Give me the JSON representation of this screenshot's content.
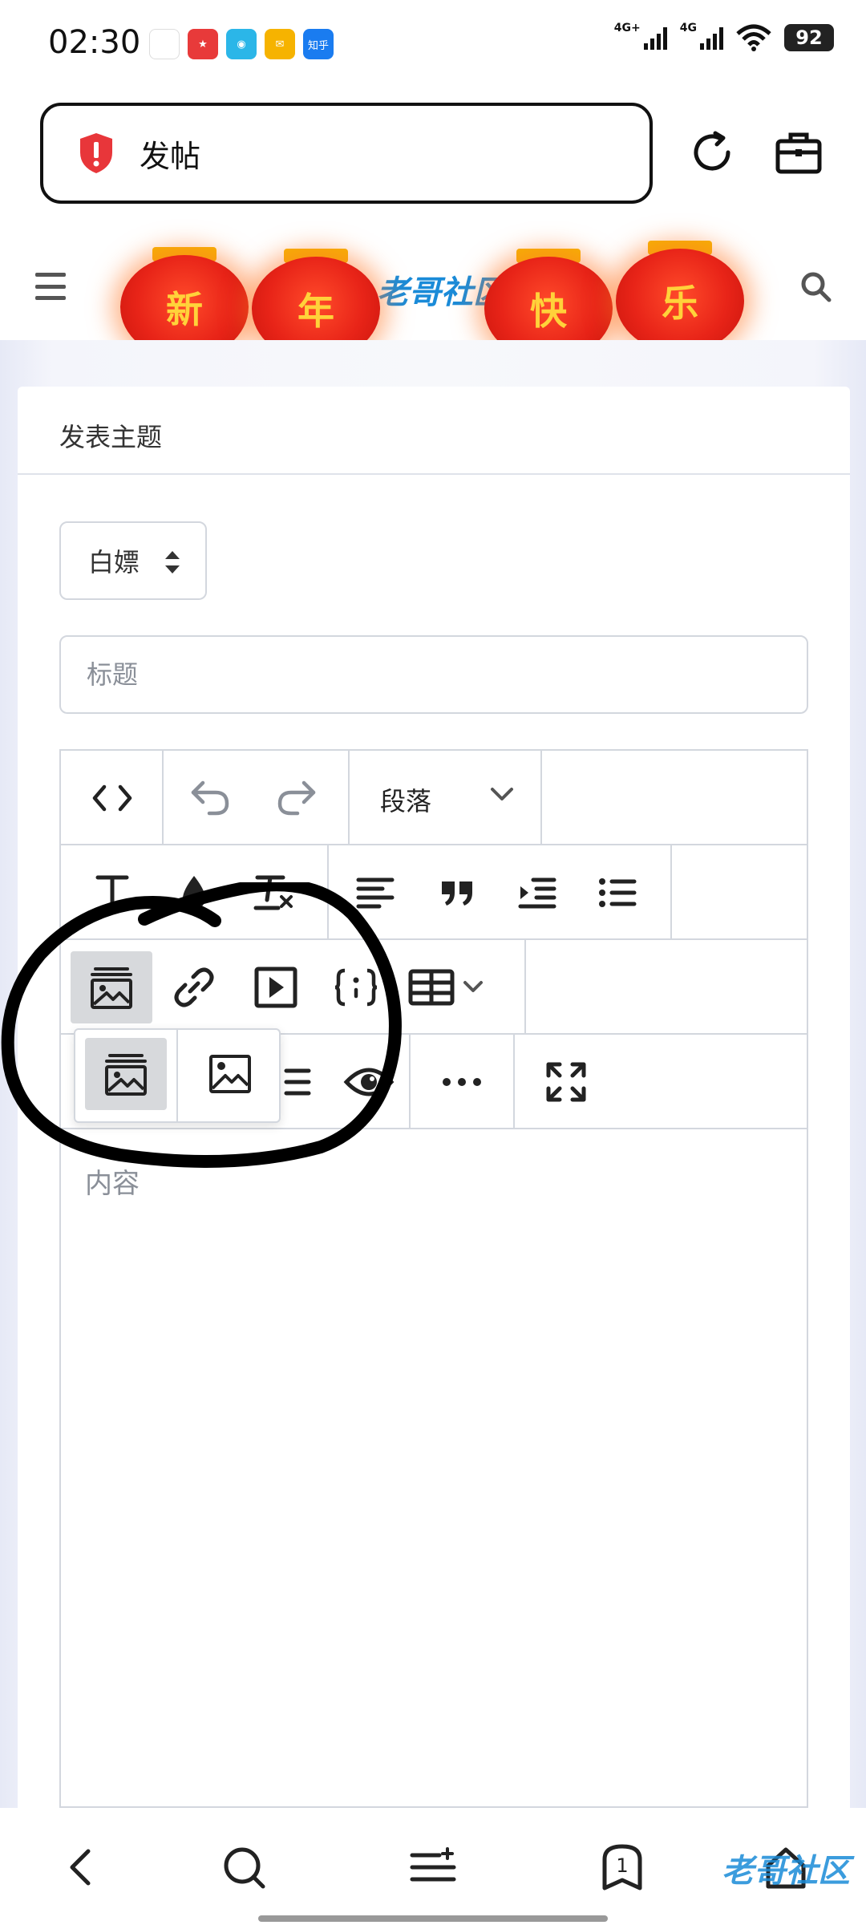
{
  "status_bar": {
    "time": "02:30",
    "net1": "4G+",
    "net2": "4G",
    "battery": "92",
    "app_icons": [
      "blank-app",
      "taobao-app",
      "qq-app",
      "mail-app",
      "zhihu-app"
    ],
    "zhihu_label": "知乎"
  },
  "browser": {
    "address_text": "发帖",
    "security_icon": "shield-alert-icon",
    "reload_icon": "reload-icon",
    "toolbox_icon": "toolbox-icon"
  },
  "site_header": {
    "logo_text": "老哥社区",
    "lanterns": [
      "新",
      "年",
      "快",
      "乐"
    ]
  },
  "form": {
    "card_title": "发表主题",
    "category_selected": "白嫖",
    "title_placeholder": "标题",
    "content_placeholder": "内容"
  },
  "toolbar": {
    "row1": [
      "code-view-icon",
      "undo-icon",
      "redo-icon"
    ],
    "paragraph_label": "段落",
    "row2": [
      "text-style-icon",
      "text-color-icon",
      "clear-format-icon",
      "align-icon",
      "quote-icon",
      "indent-icon",
      "list-icon"
    ],
    "row3": [
      "image-gallery-icon",
      "link-icon",
      "video-icon",
      "code-block-icon",
      "table-icon"
    ],
    "row4": [
      "list-icon",
      "preview-icon",
      "more-icon",
      "fullscreen-icon"
    ],
    "image_popup": [
      "image-gallery-icon",
      "image-icon"
    ]
  },
  "bottom_nav": {
    "items": [
      "back-icon",
      "search-icon",
      "menu-icon",
      "tabs-icon",
      "home-icon"
    ],
    "tab_count": "1",
    "watermark": "老哥社区"
  },
  "colors": {
    "accent_blue": "#1a8bd8",
    "lantern_red": "#e82418",
    "lantern_gold": "#f5b400",
    "alert_red": "#e8363a"
  }
}
